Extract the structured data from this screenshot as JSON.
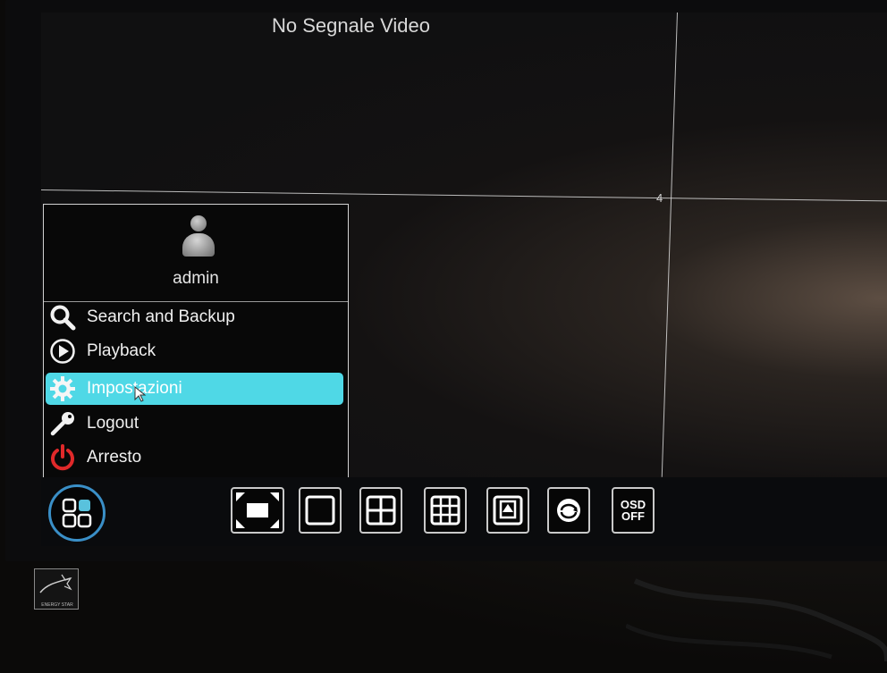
{
  "screen": {
    "channel_title": "No Segnale Video",
    "channel_number": "4"
  },
  "menu": {
    "user": {
      "name": "admin",
      "icon": "user-avatar-icon"
    },
    "items": [
      {
        "label": "Search and Backup",
        "icon": "search-icon",
        "selected": false
      },
      {
        "label": "Playback",
        "icon": "play-circle-icon",
        "selected": false
      },
      {
        "label": "Impostazioni",
        "icon": "gear-icon",
        "selected": true
      },
      {
        "label": "Logout",
        "icon": "key-icon",
        "selected": false
      },
      {
        "label": "Arresto",
        "icon": "power-icon",
        "selected": false
      }
    ]
  },
  "toolbar": {
    "buttons": [
      {
        "name": "fullscreen",
        "icon": "fullscreen-icon"
      },
      {
        "name": "single-view",
        "icon": "layout-1-icon"
      },
      {
        "name": "quad-view",
        "icon": "layout-4-icon"
      },
      {
        "name": "nine-view",
        "icon": "layout-9-icon"
      },
      {
        "name": "picture-view",
        "icon": "layout-pip-icon"
      },
      {
        "name": "sequence",
        "icon": "rotate-view-icon"
      },
      {
        "name": "osd-toggle",
        "label_top": "OSD",
        "label_bottom": "OFF"
      }
    ]
  },
  "colors": {
    "selection": "#4fd8e6",
    "home_ring": "#3a8fc7",
    "home_tile": "#59c2dd",
    "power_red": "#e0292a"
  }
}
